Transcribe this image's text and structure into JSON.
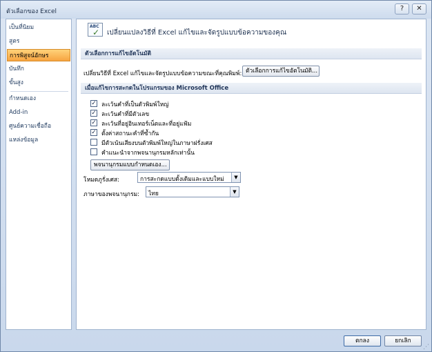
{
  "window": {
    "title": "ตัวเลือกของ Excel",
    "help_glyph": "?",
    "close_glyph": "✕"
  },
  "sidebar": {
    "items": [
      {
        "label": "เป็นที่นิยม"
      },
      {
        "label": "สูตร"
      },
      {
        "label": "การพิสูจน์อักษร"
      },
      {
        "label": "บันทึก"
      },
      {
        "label": "ขั้นสูง"
      },
      {
        "label": "กำหนดเอง"
      },
      {
        "label": "Add-in"
      },
      {
        "label": "ศูนย์ความเชื่อถือ"
      },
      {
        "label": "แหล่งข้อมูล"
      }
    ],
    "active_index": 2
  },
  "header": {
    "icon": "abc-check-icon",
    "icon_text": "ABC",
    "title": "เปลี่ยนแปลงวิธีที่ Excel แก้ไขและจัดรูปแบบข้อความของคุณ"
  },
  "autocorrect": {
    "section_title": "ตัวเลือกการแก้ไขอัตโนมัติ",
    "description": "เปลี่ยนวิธีที่ Excel แก้ไขและจัดรูปแบบข้อความขณะที่คุณพิมพ์:",
    "button_label": "ตัวเลือกการแก้ไขอัตโนมัติ..."
  },
  "spelling": {
    "section_title": "เมื่อแก้ไขการสะกดในโปรแกรมของ Microsoft Office",
    "checkboxes": [
      {
        "label": "ละเว้นคำที่เป็นตัวพิมพ์ใหญ่",
        "checked": true
      },
      {
        "label": "ละเว้นคำที่มีตัวเลข",
        "checked": true
      },
      {
        "label": "ละเว้นที่อยู่อินเทอร์เน็ตและที่อยู่แฟ้ม",
        "checked": true
      },
      {
        "label": "ตั้งค่าสถานะคำที่ซ้ำกัน",
        "checked": true
      },
      {
        "label": "มีตัวเน้นเสียงบนตัวพิมพ์ใหญ่ในภาษาฝรั่งเศส",
        "checked": false
      },
      {
        "label": "คำแนะนำจากพจนานุกรมหลักเท่านั้น",
        "checked": false
      }
    ],
    "custom_dict_button": "พจนานุกรมแบบกำหนดเอง...",
    "french_modes_label": "โหมดภูรั่งเศส:",
    "french_modes_value": "การสะกดแบบดั้งเดิมและแบบใหม่",
    "dict_language_label": "ภาษาของพจนานุกรม:",
    "dict_language_value": "ไทย",
    "check_glyph": "✓",
    "dropdown_glyph": "▼"
  },
  "footer": {
    "ok_label": "ตกลง",
    "cancel_label": "ยกเลิก",
    "grip_glyph": "⋰"
  }
}
